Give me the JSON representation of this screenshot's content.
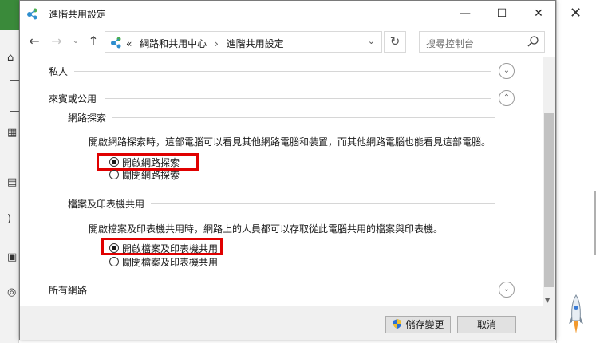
{
  "window": {
    "title": "進階共用設定",
    "minimize": "—",
    "maximize": "☐",
    "close": "✕"
  },
  "nav": {
    "back": "←",
    "forward": "→",
    "history": "⌄",
    "up": "↑",
    "breadcrumb_prefix": "«",
    "crumb1": "網路和共用中心",
    "separator": "›",
    "crumb2": "進階共用設定",
    "dropdown": "⌄",
    "refresh": "↻",
    "search_placeholder": "搜尋控制台"
  },
  "sections": {
    "private": {
      "label": "私人",
      "chevron": "⌄"
    },
    "guest": {
      "label": "來賓或公用",
      "chevron": "⌃"
    },
    "all": {
      "label": "所有網路",
      "chevron": "⌄"
    }
  },
  "discovery": {
    "heading": "網路探索",
    "description": "開啟網路探索時，這部電腦可以看見其他網路電腦和裝置，而其他網路電腦也能看見這部電腦。",
    "option_on": "開啟網路探索",
    "option_off": "關閉網路探索",
    "selected": "on"
  },
  "sharing": {
    "heading": "檔案及印表機共用",
    "description": "開啟檔案及印表機共用時，網路上的人員都可以存取從此電腦共用的檔案與印表機。",
    "option_on": "開啟檔案及印表機共用",
    "option_off": "關閉檔案及印表機共用",
    "selected": "on"
  },
  "footer": {
    "save_label": "儲存變更",
    "cancel_label": "取消"
  },
  "background": {
    "close": "✕"
  },
  "colors": {
    "highlight": "#e00000",
    "accent": "#3a8a3a"
  }
}
